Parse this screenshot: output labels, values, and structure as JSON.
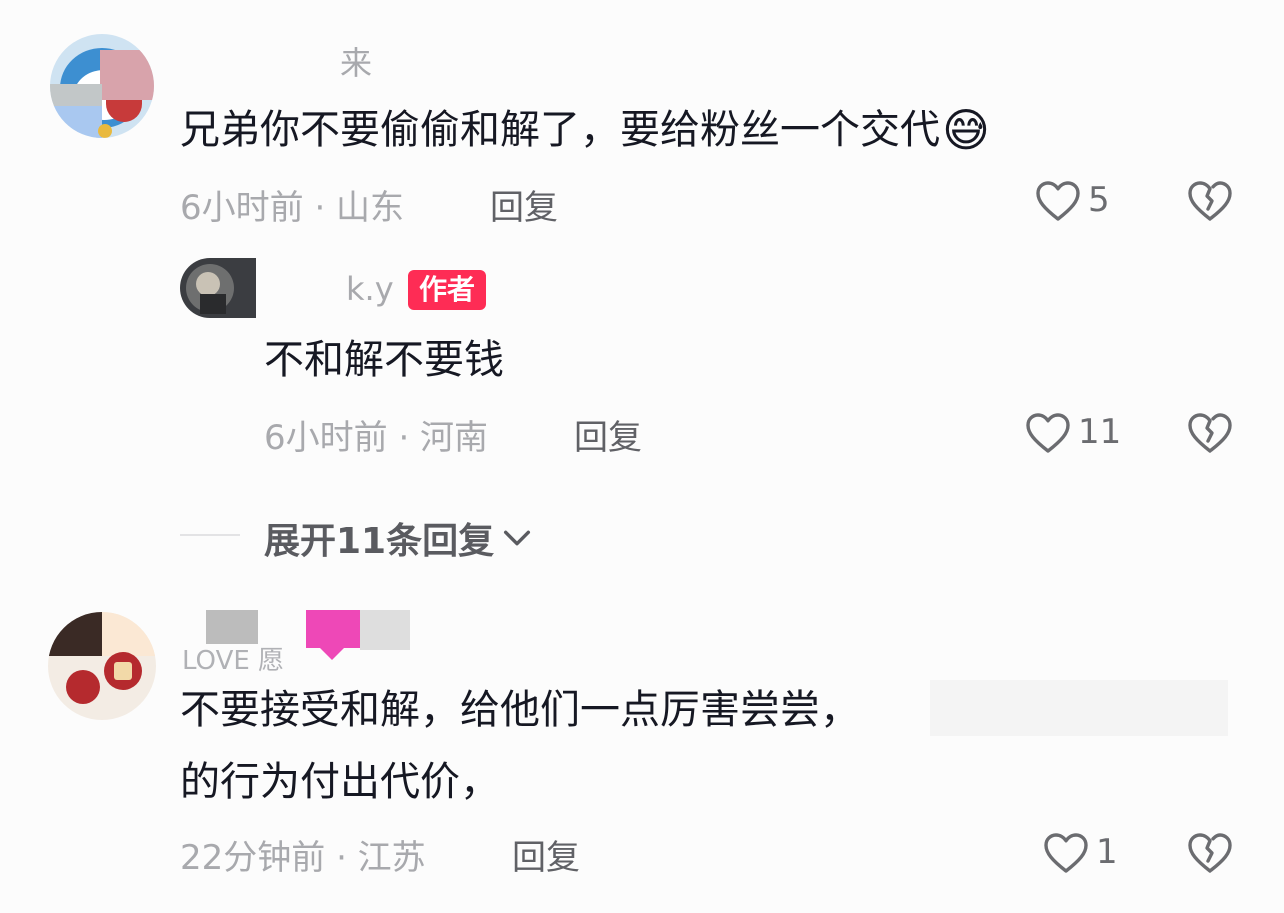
{
  "comments": [
    {
      "username": "来",
      "text": "兄弟你不要偷偷和解了，要给粉丝一个交代",
      "emoji": "😅",
      "meta": "6小时前 · 山东",
      "reply_label": "回复",
      "likes": "5",
      "reply": {
        "username": "k.y",
        "badge": "作者",
        "text": "不和解不要钱",
        "meta": "6小时前 · 河南",
        "reply_label": "回复",
        "likes": "11"
      },
      "expand_label": "展开11条回复"
    },
    {
      "username": "LOVE 愿",
      "text_line1": "不要接受和解，给他们一点厉害尝尝，",
      "text_line2": "的行为付出代价，",
      "meta": "22分钟前 · 江苏",
      "reply_label": "回复",
      "likes": "1"
    }
  ],
  "colors": {
    "author_badge": "#fe2c55",
    "meta_text": "#a8a9ad",
    "icon_stroke": "#6b6c70"
  },
  "icons": [
    "heart-outline-icon",
    "broken-heart-icon",
    "chevron-down-icon"
  ]
}
